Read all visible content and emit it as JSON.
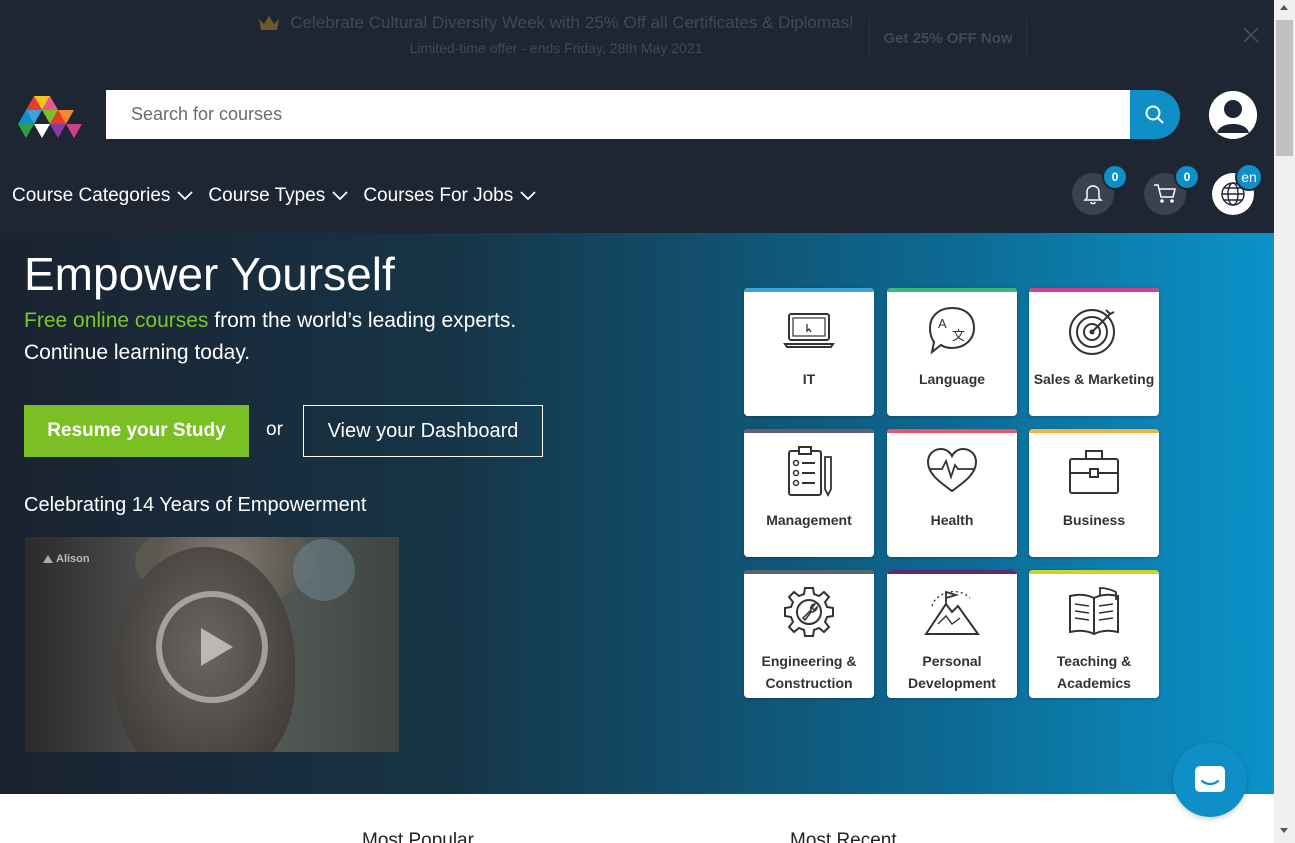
{
  "promo": {
    "title": "Celebrate Cultural Diversity Week with 25% Off all Certificates & Diplomas!",
    "subtitle": "Limited-time offer - ends Friday, 28th May 2021",
    "cta": "Get 25% OFF Now"
  },
  "search": {
    "placeholder": "Search for courses"
  },
  "nav": {
    "items": [
      {
        "label": "Course Categories"
      },
      {
        "label": "Course Types"
      },
      {
        "label": "Courses For Jobs"
      }
    ]
  },
  "header_icons": {
    "notifications_count": "0",
    "cart_count": "0",
    "language": "en"
  },
  "hero": {
    "title": "Empower Yourself",
    "subtitle_highlight": "Free online courses",
    "subtitle_rest": " from the world’s leading experts.",
    "subtitle_line2": "Continue learning today.",
    "resume_label": "Resume your Study",
    "or_label": "or",
    "dashboard_label": "View your Dashboard",
    "celebrate_label": "Celebrating 14 Years of Empowerment",
    "video_logo": "Alison"
  },
  "categories": [
    {
      "label": "IT",
      "icon": "laptop-icon",
      "color": "#3aa3dc"
    },
    {
      "label": "Language",
      "icon": "translate-bubble-icon",
      "color": "#3cb878"
    },
    {
      "label": "Sales & Marketing",
      "icon": "target-icon",
      "color": "#d23f8a"
    },
    {
      "label": "Management",
      "icon": "clipboard-icon",
      "color": "#5a6470"
    },
    {
      "label": "Health",
      "icon": "heart-pulse-icon",
      "color": "#e8556b"
    },
    {
      "label": "Business",
      "icon": "briefcase-icon",
      "color": "#f0b43c"
    },
    {
      "label": "Engineering & Construction",
      "icon": "gear-wrench-icon",
      "color": "#5a6470"
    },
    {
      "label": "Personal Development",
      "icon": "mountain-flag-icon",
      "color": "#5b2d6e"
    },
    {
      "label": "Teaching & Academics",
      "icon": "open-book-icon",
      "color": "#c8d530"
    }
  ],
  "bottom_tabs": {
    "most_popular": "Most Popular",
    "most_recent": "Most Recent"
  }
}
